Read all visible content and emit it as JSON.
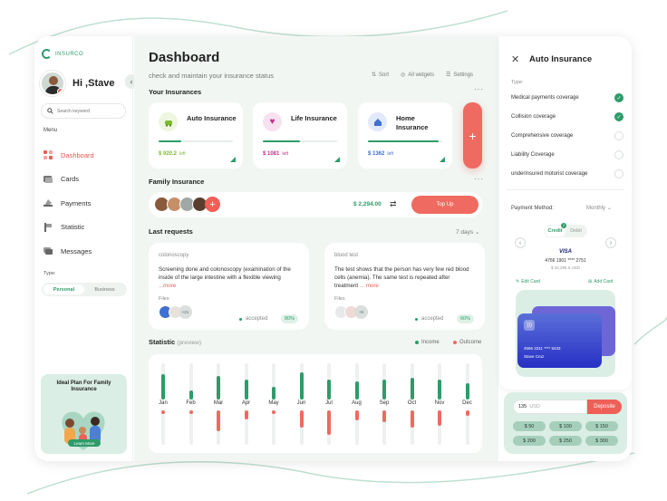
{
  "brand": {
    "name": "INSURCO",
    "accent": "#2e9b6a",
    "alert": "#ef5f57"
  },
  "user": {
    "greeting": "Hi ,Stave"
  },
  "sidebar": {
    "search_placeholder": "Search keyword",
    "menu_label": "Menu",
    "items": [
      {
        "label": "Dashboard",
        "icon": "dashboard-icon",
        "active": true
      },
      {
        "label": "Cards",
        "icon": "cards-icon"
      },
      {
        "label": "Payments",
        "icon": "payments-icon"
      },
      {
        "label": "Statistic",
        "icon": "statistic-icon"
      },
      {
        "label": "Messages",
        "icon": "messages-icon"
      }
    ],
    "type_label": "Type:",
    "type_options": [
      "Personal",
      "Business"
    ],
    "type_selected": "Personal",
    "promo": {
      "title": "Ideal Plan For Family Insurance",
      "button": "Learn More"
    }
  },
  "header": {
    "title": "Dashboard",
    "subtitle": "check and maintain your insurance status",
    "tools": [
      "Sort",
      "All widgets",
      "Settings"
    ]
  },
  "insurances": {
    "title": "Your Insurances",
    "cards": [
      {
        "name": "Auto Insurance",
        "amount": "$ 920.2",
        "left": "left",
        "progress": 0.3,
        "color": "#7dbb2e",
        "icon": "car-icon"
      },
      {
        "name": "Life Insurance",
        "amount": "$ 1081",
        "left": "left",
        "progress": 0.5,
        "color": "#c4338a",
        "icon": "heart-icon"
      },
      {
        "name": "Home Insurance",
        "amount": "$ 1362",
        "left": "left",
        "progress": 0.95,
        "color": "#3f6fd0",
        "icon": "home-icon"
      }
    ],
    "add_label": "+"
  },
  "family": {
    "title": "Family Insurance",
    "amount": "$ 2,294.00",
    "button": "Top Up"
  },
  "requests": {
    "title": "Last requests",
    "filter": "7 days",
    "items": [
      {
        "tag": "colonoscopy",
        "text": "Screening done and colonoscopy (examination of the inside of the large intestine with a flexible viewing",
        "more": "...more",
        "files_label": "Files",
        "file_count": "+21",
        "status": "accepted",
        "percent": "80%"
      },
      {
        "tag": "blood test",
        "text": "The test shows that the person has very few red blood cells (anemia). The same test is repeated after treatment",
        "more": "... more",
        "files_label": "Files",
        "file_count": "+9",
        "status": "accepted",
        "percent": "60%"
      }
    ]
  },
  "statistic": {
    "title": "Statistic",
    "note": "(preview)",
    "legend": [
      {
        "label": "Income",
        "color": "#2e9b6a"
      },
      {
        "label": "Outcome",
        "color": "#ef6a60"
      }
    ],
    "months": [
      "Jan",
      "Feb",
      "Mar",
      "Apr",
      "May",
      "Jun",
      "Jul",
      "Aug",
      "Sep",
      "Oct",
      "Nov",
      "Dec"
    ],
    "income": [
      0.7,
      0.25,
      0.65,
      0.55,
      0.35,
      0.75,
      0.55,
      0.5,
      0.55,
      0.6,
      0.55,
      0.45
    ],
    "outcome": [
      0.1,
      0.08,
      0.6,
      0.25,
      0.08,
      0.5,
      0.7,
      0.3,
      0.35,
      0.5,
      0.45,
      0.15
    ]
  },
  "auto_panel": {
    "title": "Auto Insurance",
    "type_label": "Type:",
    "coverages": [
      {
        "label": "Medical payments coverage",
        "checked": true
      },
      {
        "label": "Collision coverage",
        "checked": true
      },
      {
        "label": "Comprehensive coverage",
        "checked": false
      },
      {
        "label": "Liability Coverage",
        "checked": false
      },
      {
        "label": "underinsured motorist coverage",
        "checked": false
      }
    ],
    "payment_label": "Payment Method:",
    "payment_freq": "Monthly",
    "card_tabs": [
      "Credit",
      "Debit"
    ],
    "card_badge": "2",
    "card_brand": "VISA",
    "card_number": "4766 1901 **** 2751",
    "card_balance": "$ 34,295.5 USD",
    "edit_card": "Edit Card",
    "add_card": "Add Card",
    "front_number": "4566 3311 **** 5433",
    "front_name": "Stave Cruz",
    "deposit_value": "135",
    "deposit_currency": "USD",
    "deposit_button": "Deposite",
    "chips": [
      "$ 50",
      "$ 100",
      "$ 150",
      "$ 200",
      "$ 250",
      "$ 300"
    ]
  }
}
